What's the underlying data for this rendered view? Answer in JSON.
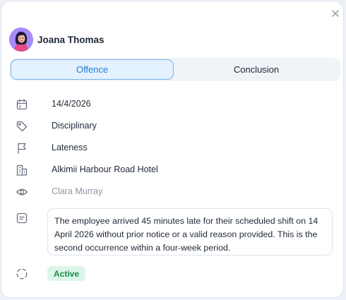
{
  "user": {
    "name": "Joana Thomas"
  },
  "tabs": [
    {
      "label": "Offence",
      "active": true
    },
    {
      "label": "Conclusion",
      "active": false
    }
  ],
  "details": {
    "date": "14/4/2026",
    "category": "Disciplinary",
    "type": "Lateness",
    "location": "Alkimii Harbour Road Hotel",
    "observer": "Clara Murray",
    "description": "The employee arrived 45 minutes late for their scheduled shift on 14 April 2026 without prior notice or a valid reason provided. This is the second occurrence within a four-week period.",
    "status": "Active"
  },
  "icons": {
    "close": "close-icon",
    "date": "calendar-icon",
    "category": "tag-icon",
    "type": "flag-icon",
    "location": "building-icon",
    "observer": "eye-icon",
    "description": "note-icon",
    "status": "status-dashed-circle-icon"
  },
  "colors": {
    "accent": "#1f7ad6",
    "tab_active_bg": "#e3f2fe",
    "status_bg": "#dcf5e8",
    "status_text": "#1a8a4a"
  }
}
